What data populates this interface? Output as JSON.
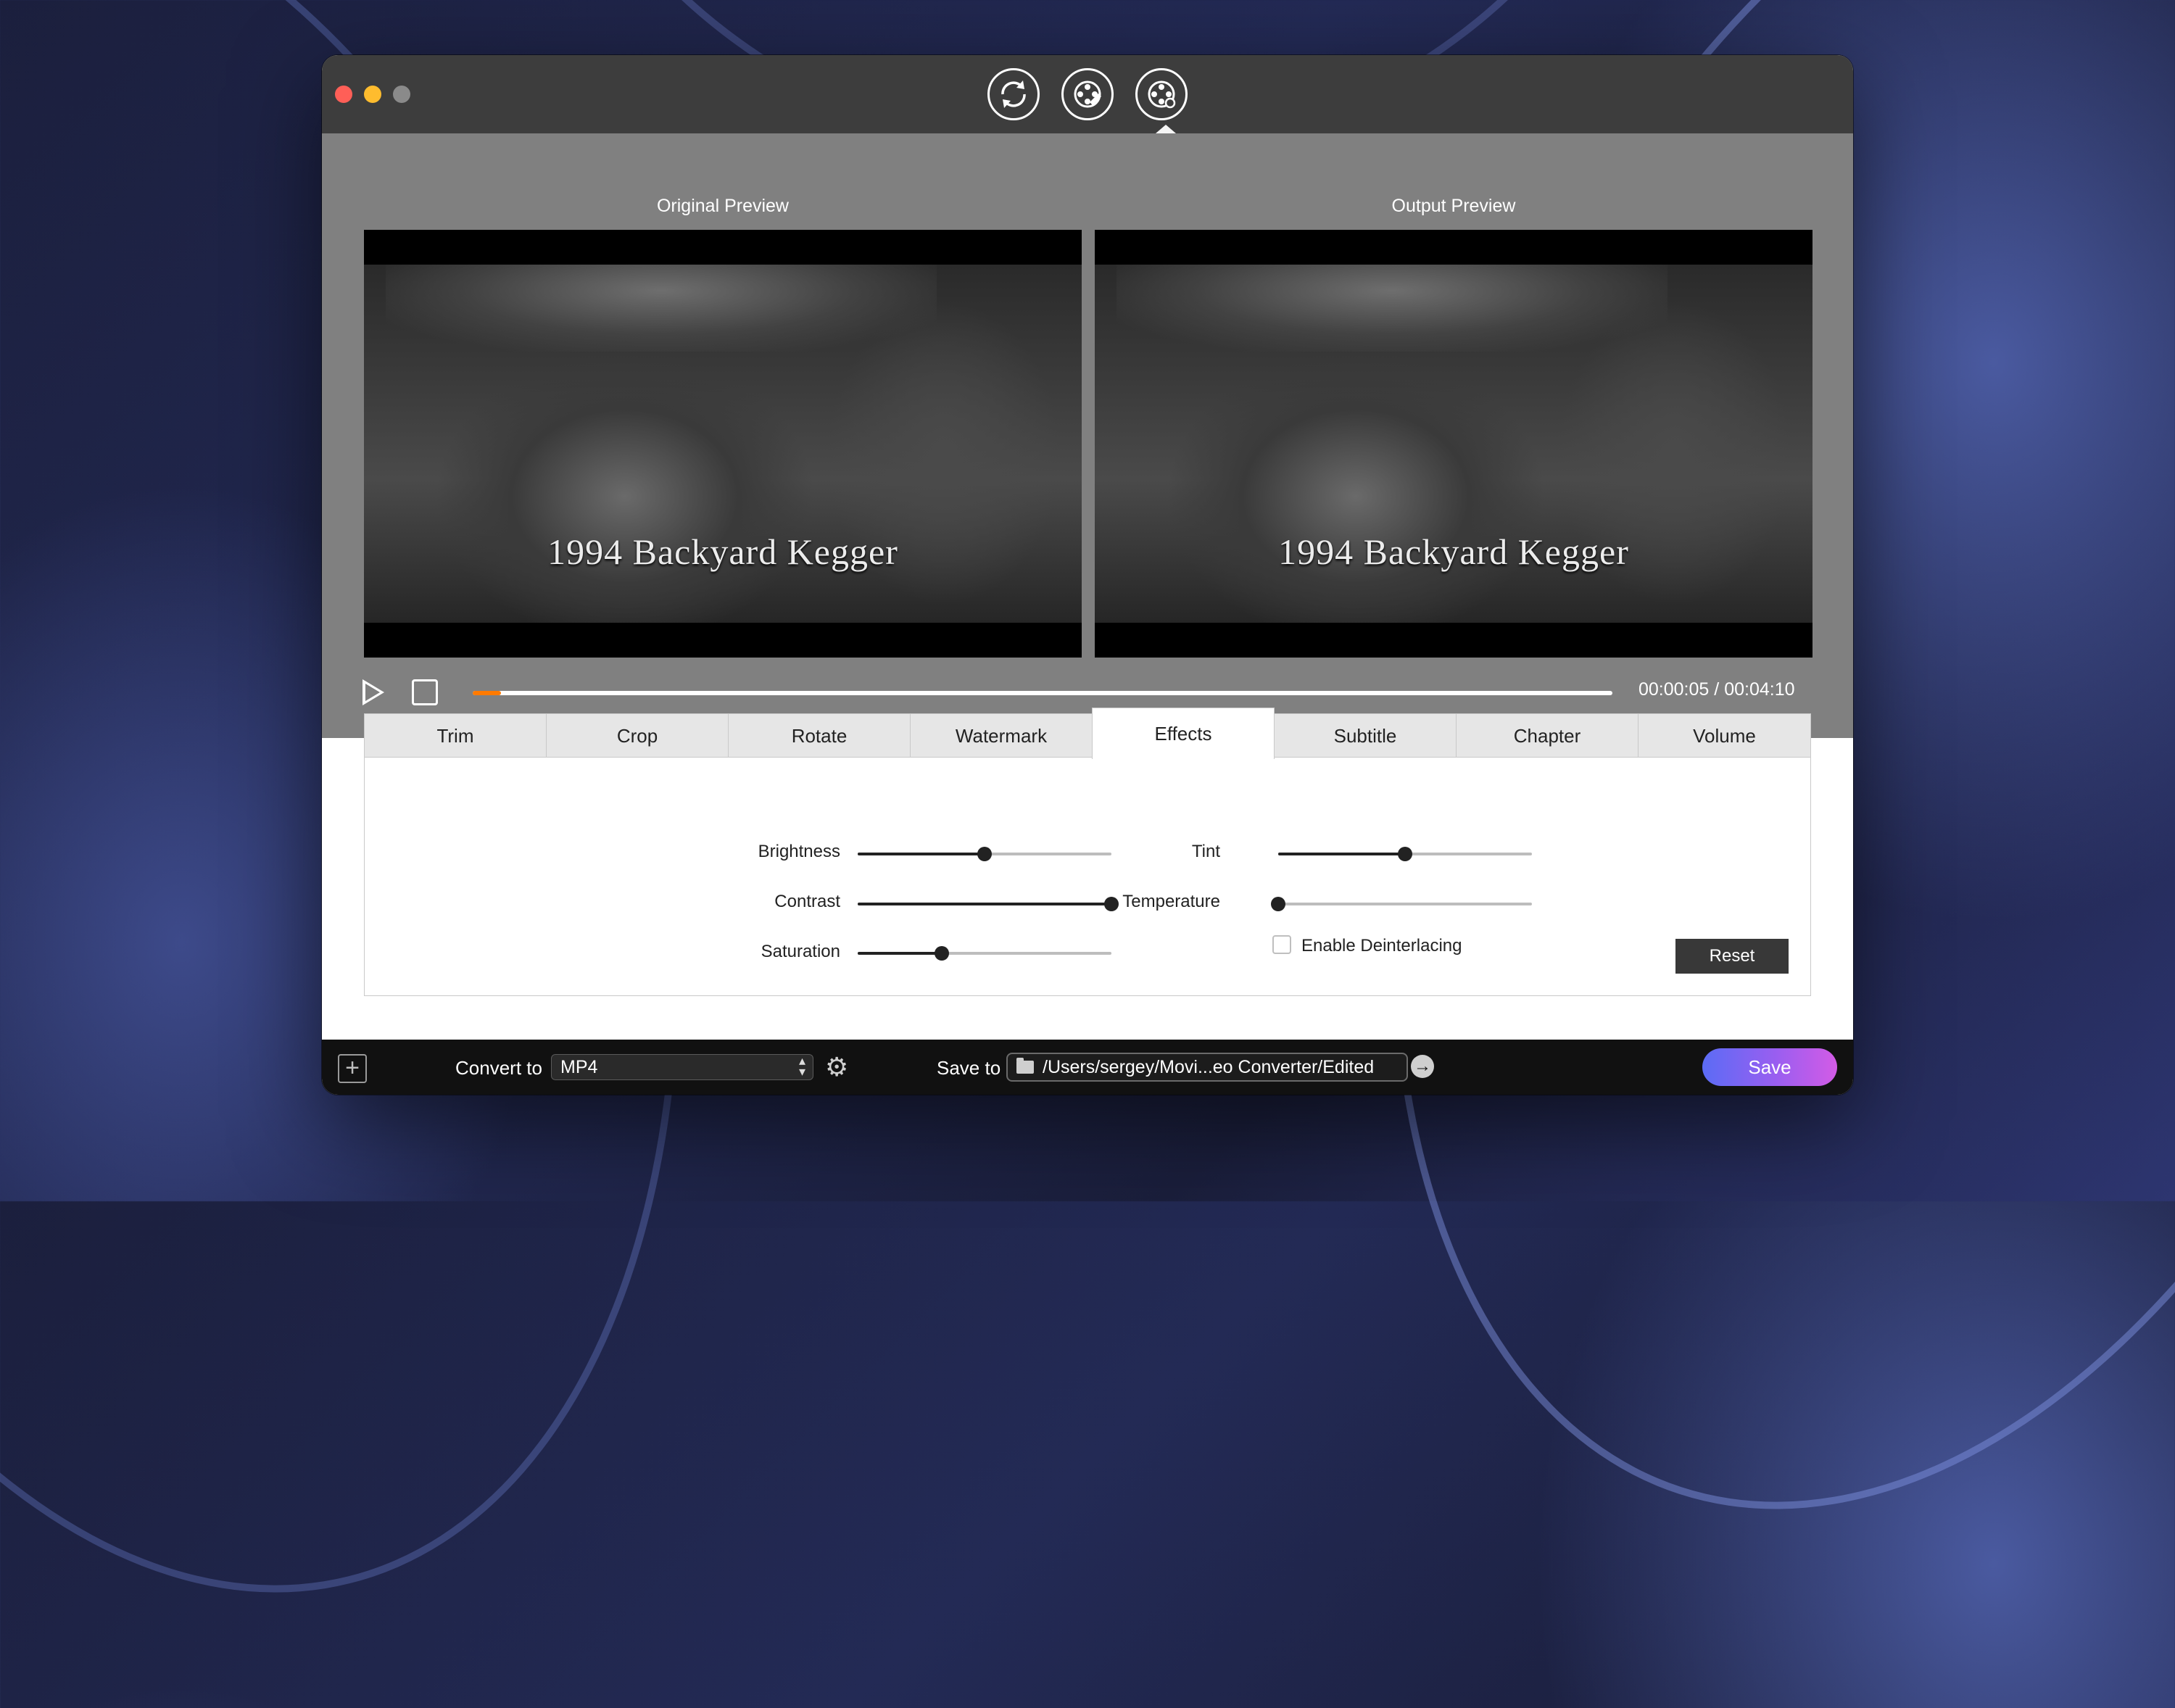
{
  "window": {
    "toolbar_icons": [
      "convert-icon",
      "edit-video-icon",
      "video-effects-icon"
    ]
  },
  "preview": {
    "original_label": "Original Preview",
    "output_label": "Output Preview",
    "video_caption": "1994 Backyard Kegger",
    "playback_progress": 0.025,
    "time_current": "00:00:05",
    "time_separator": "/",
    "time_total": "00:04:10"
  },
  "tabs": [
    "Trim",
    "Crop",
    "Rotate",
    "Watermark",
    "Effects",
    "Subtitle",
    "Chapter",
    "Volume"
  ],
  "active_tab": "Effects",
  "effects": {
    "brightness": {
      "label": "Brightness",
      "value": 0.5
    },
    "contrast": {
      "label": "Contrast",
      "value": 1.0
    },
    "saturation": {
      "label": "Saturation",
      "value": 0.33
    },
    "tint": {
      "label": "Tint",
      "value": 0.5
    },
    "temperature": {
      "label": "Temperature",
      "value": 0.0
    },
    "deinterlace_label": "Enable Deinterlacing",
    "deinterlace_checked": false,
    "reset_label": "Reset"
  },
  "bottom": {
    "convert_label": "Convert to",
    "format_value": "MP4",
    "save_to_label": "Save to",
    "save_path": "/Users/sergey/Movi...eo Converter/Edited",
    "save_button": "Save"
  },
  "colors": {
    "progress_accent": "#ff7a00",
    "save_gradient_start": "#5b6cf5",
    "save_gradient_end": "#d35be6"
  }
}
